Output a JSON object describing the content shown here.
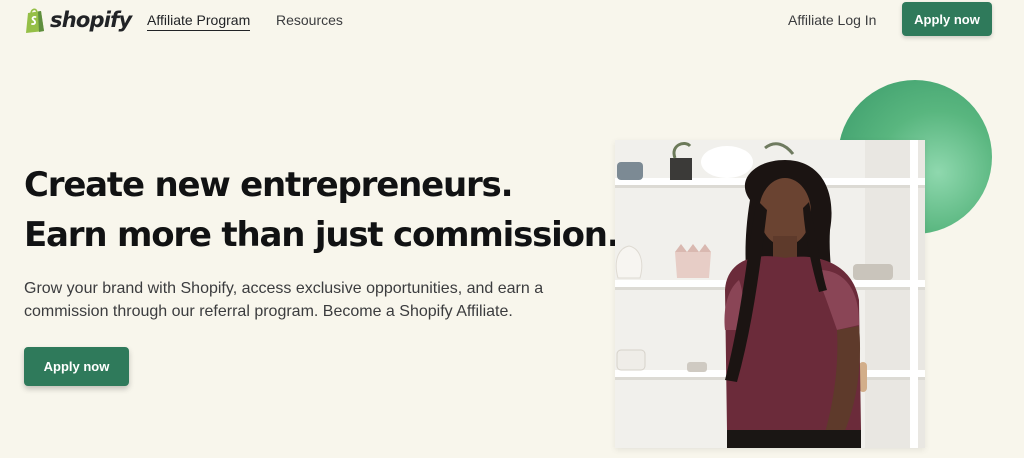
{
  "header": {
    "logo_text": "shopify",
    "nav": {
      "affiliate_program": "Affiliate Program",
      "resources": "Resources",
      "login": "Affiliate Log In"
    },
    "cta_label": "Apply now"
  },
  "hero": {
    "headline_line1": "Create new entrepreneurs.",
    "headline_line2": "Earn more than just commission.",
    "subtext": "Grow your brand with Shopify, access exclusive opportunities, and earn a commission through our referral program. Become a Shopify Affiliate.",
    "cta_label": "Apply now"
  },
  "colors": {
    "background": "#f8f6ec",
    "brand_green": "#2f7a5b",
    "accent_circle": "#59b67f",
    "logo_green": "#95bf47"
  },
  "icons": {
    "logo": "shopify-bag-icon"
  }
}
